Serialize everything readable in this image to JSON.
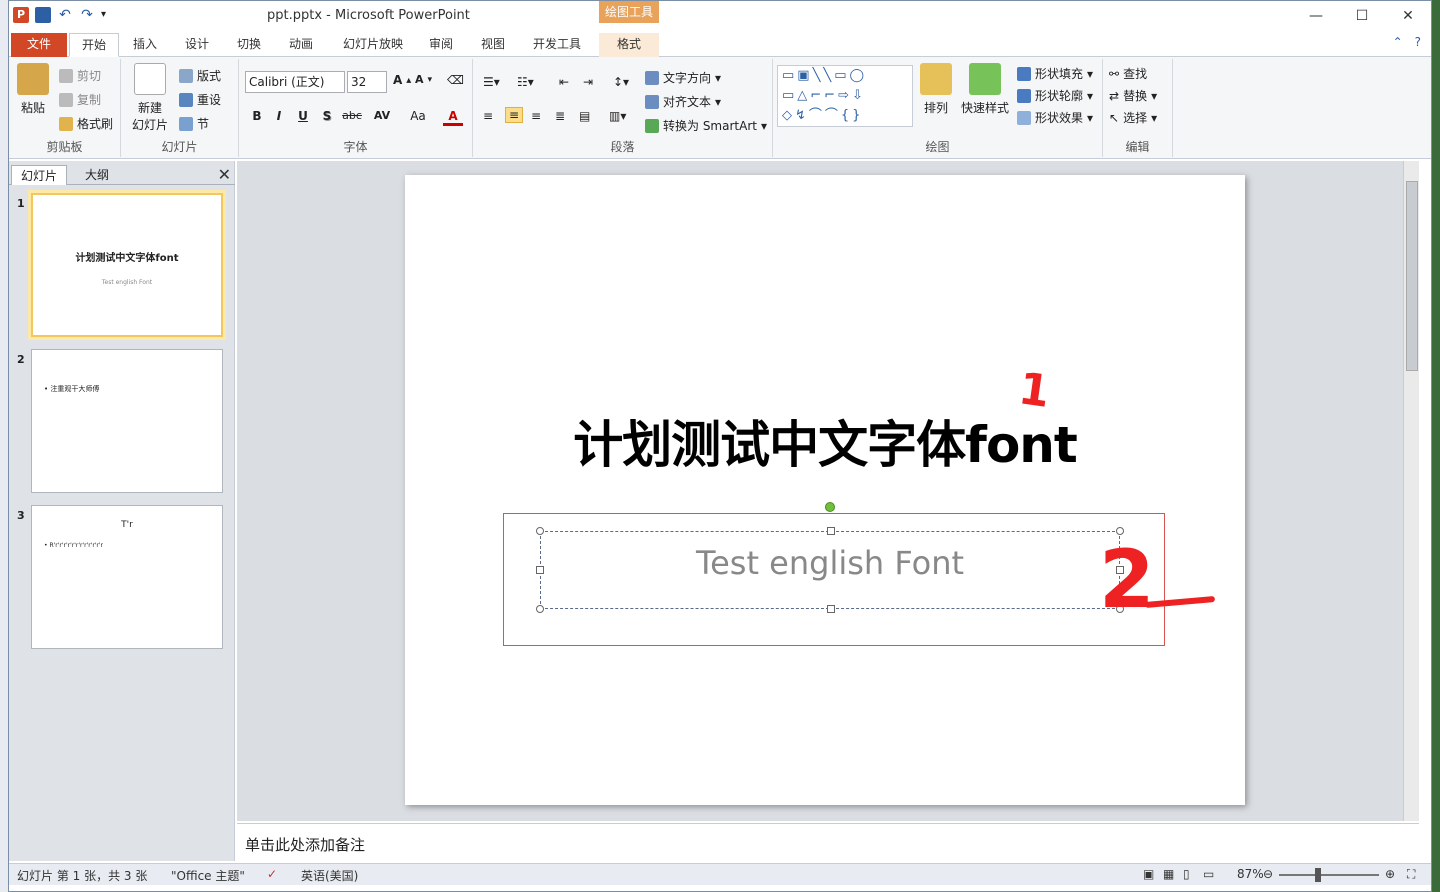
{
  "window": {
    "filename": "ppt.pptx",
    "app": "Microsoft PowerPoint",
    "title_sep": "-",
    "context_tab_header": "绘图工具"
  },
  "qat": {
    "app_letter": "P"
  },
  "tabs": {
    "file": "文件",
    "home": "开始",
    "insert": "插入",
    "design": "设计",
    "transitions": "切换",
    "animations": "动画",
    "slideshow": "幻灯片放映",
    "review": "审阅",
    "view": "视图",
    "developer": "开发工具",
    "format": "格式"
  },
  "ribbon": {
    "clipboard": {
      "label": "剪贴板",
      "paste": "粘贴",
      "cut": "剪切",
      "copy": "复制",
      "format_painter": "格式刷"
    },
    "slides": {
      "label": "幻灯片",
      "new_slide_line1": "新建",
      "new_slide_line2": "幻灯片",
      "layout": "版式",
      "reset": "重设",
      "section": "节"
    },
    "font": {
      "label": "字体",
      "font_name": "Calibri (正文)",
      "font_size": "32",
      "bold": "B",
      "italic": "I",
      "underline": "U",
      "shadow": "S",
      "strike": "abc",
      "spacing": "AV",
      "case": "Aa",
      "color": "A"
    },
    "paragraph": {
      "label": "段落",
      "text_direction": "文字方向",
      "align_text": "对齐文本",
      "smartart": "转换为 SmartArt"
    },
    "drawing": {
      "label": "绘图",
      "arrange": "排列",
      "quick_styles": "快速样式",
      "shape_fill": "形状填充",
      "shape_outline": "形状轮廓",
      "shape_effects": "形状效果"
    },
    "editing": {
      "label": "编辑",
      "find": "查找",
      "replace": "替换",
      "select": "选择"
    }
  },
  "panel": {
    "tab_slides": "幻灯片",
    "tab_outline": "大纲",
    "thumbnails": [
      {
        "num": "1",
        "title": "计划测试中文字体font",
        "sub": "Test english Font"
      },
      {
        "num": "2",
        "bullet": "注重观干大师傅"
      },
      {
        "num": "3",
        "title": "T'r",
        "bullet": "R'r'r'r'r'r'r'r'r'r'r'r'r"
      }
    ]
  },
  "slide": {
    "title": "计划测试中文字体font",
    "subtitle": "Test english Font"
  },
  "annotations": {
    "one": "1",
    "two": "2"
  },
  "notes": {
    "placeholder": "单击此处添加备注"
  },
  "status": {
    "slide_info": "幻灯片 第 1 张，共 3 张",
    "theme": "\"Office 主题\"",
    "language": "英语(美国)",
    "zoom": "87%"
  }
}
